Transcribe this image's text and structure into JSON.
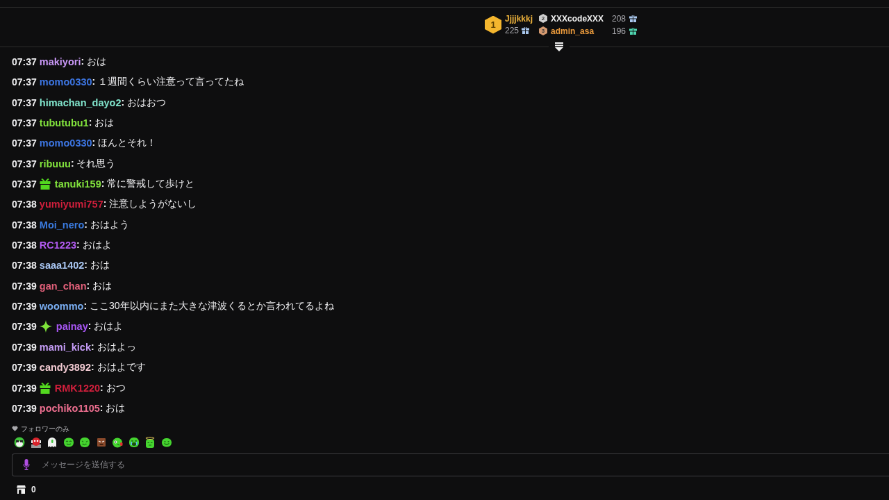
{
  "leaderboard": [
    {
      "badge": {
        "rank": "1",
        "color": "#f4b62e"
      },
      "name": {
        "text": "Jjjjkkkj",
        "color": "#f0b43c"
      },
      "gifts": {
        "count": "225",
        "color": "#a9c7ee"
      }
    },
    {
      "badge": {
        "rank": "2",
        "color": "#cfcfcf"
      },
      "name": {
        "text": "XXXcodeXXX",
        "color": "#f2f2f2"
      },
      "gifts": {
        "count": "208",
        "color": "#a9c7ee"
      }
    },
    {
      "badge": {
        "rank": "3",
        "color": "#d59a70"
      },
      "name": {
        "text": "admin_asa",
        "color": "#ea9a3c"
      },
      "gifts": {
        "count": "196",
        "color": "#4fd6b0"
      }
    }
  ],
  "messages": [
    {
      "time": "07:37",
      "user": "makiyori",
      "color": "#c897f6",
      "text": "**:** おは"
    },
    {
      "time": "07:37",
      "user": "momo0330",
      "color": "#3d76e3",
      "text": "**:** １週間くらい注意って言ってたね"
    },
    {
      "time": "07:37",
      "user": "himachan_dayo2",
      "color": "#80e3cb",
      "text": "**:** おはおつ"
    },
    {
      "time": "07:37",
      "user": "tubutubu1",
      "color": "#82e33d",
      "text": "**:** おは"
    },
    {
      "time": "07:37",
      "user": "momo0330",
      "color": "#3d76e3",
      "text": "**:** ほんとそれ！"
    },
    {
      "time": "07:37",
      "user": "ribuuu",
      "color": "#82e33d",
      "text": "**:** それ思う"
    },
    {
      "time": "07:37",
      "badge": {
        "kind": "gift"
      },
      "user": "tanuki159",
      "color": "#82e33d",
      "text": "**:** 常に警戒して歩けと"
    },
    {
      "time": "07:38",
      "user": "yumiyumi757",
      "color": "#d11f3c",
      "text": "**:** 注意しようがないし"
    },
    {
      "time": "07:38",
      "user": "Moi_nero",
      "color": "#3a7be0",
      "text": "**:** おはよう"
    },
    {
      "time": "07:38",
      "user": "RC1223",
      "color": "#b25bf2",
      "text": "**:** おはよ"
    },
    {
      "time": "07:38",
      "user": "saaa1402",
      "color": "#a9c6f2",
      "text": "**:** おは"
    },
    {
      "time": "07:39",
      "user": "gan_chan",
      "color": "#e2607a",
      "text": "**:** おは"
    },
    {
      "time": "07:39",
      "user": "woommo",
      "color": "#7aaef2",
      "text": "**:** ここ30年以内にまた大きな津波くるとか言われてるよね"
    },
    {
      "time": "07:39",
      "badge": {
        "kind": "sparkle"
      },
      "user": "painay",
      "color": "#a957f6",
      "text": "**:** おはよ"
    },
    {
      "time": "07:39",
      "user": "mami_kick",
      "color": "#c59cf6",
      "text": "**:** おはよっ"
    },
    {
      "time": "07:39",
      "user": "candy3892",
      "color": "#f3cbd3",
      "text": "**:** おはよです"
    },
    {
      "time": "07:39",
      "badge": {
        "kind": "gift"
      },
      "user": "RMK1220",
      "color": "#d11f3c",
      "text": "**:** おつ"
    },
    {
      "time": "07:39",
      "user": "pochiko1105",
      "color": "#ee6f90",
      "text": "**:** おは"
    }
  ],
  "filter": {
    "label": "フォロワーのみ"
  },
  "composer": {
    "placeholder": "メッセージを送信する"
  },
  "footer": {
    "count": "0"
  }
}
